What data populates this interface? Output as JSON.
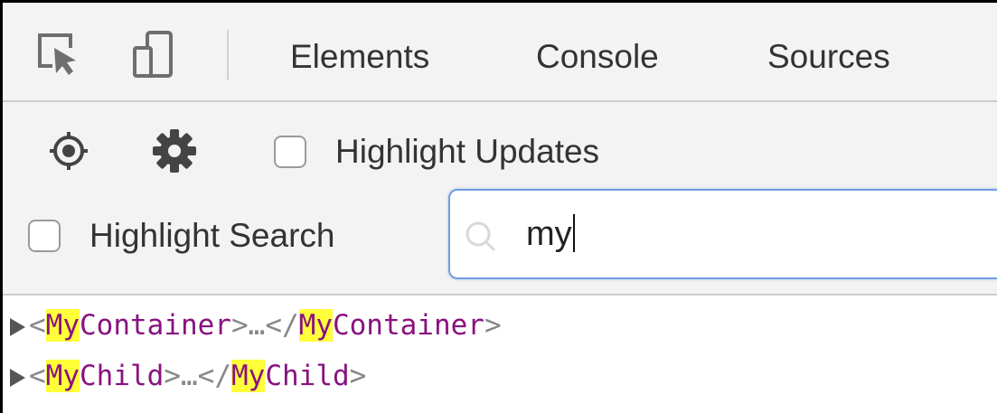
{
  "toolbar": {
    "tabs": [
      {
        "label": "Elements"
      },
      {
        "label": "Console"
      },
      {
        "label": "Sources"
      }
    ]
  },
  "controls": {
    "highlight_updates_label": "Highlight Updates",
    "highlight_updates_checked": false,
    "highlight_search_label": "Highlight Search",
    "highlight_search_checked": false,
    "search_value": "my"
  },
  "tree": {
    "rows": [
      {
        "open": "<",
        "match": "My",
        "rest": "Container",
        "close_open": ">",
        "ellipsis": "…",
        "end_open": "</",
        "end_match": "My",
        "end_rest": "Container",
        "end_close": ">"
      },
      {
        "open": "<",
        "match": "My",
        "rest": "Child",
        "close_open": ">",
        "ellipsis": "…",
        "end_open": "</",
        "end_match": "My",
        "end_rest": "Child",
        "end_close": ">"
      }
    ]
  },
  "colors": {
    "tag": "#881280",
    "match_highlight": "#ffff3a",
    "search_focus_border": "#6f9fe0",
    "panel_background": "#f3f3f3"
  }
}
